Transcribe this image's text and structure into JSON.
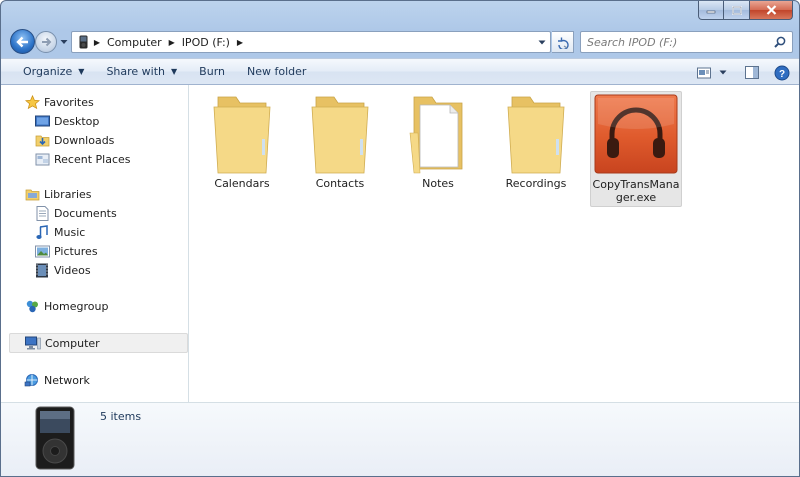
{
  "window": {
    "caption_buttons": [
      "minimize",
      "maximize",
      "close"
    ]
  },
  "address": {
    "breadcrumbs": [
      "Computer",
      "IPOD (F:)"
    ],
    "drive_icon": "ipod-drive-icon"
  },
  "search": {
    "placeholder": "Search IPOD (F:)"
  },
  "toolbar": {
    "organize_label": "Organize",
    "share_label": "Share with",
    "burn_label": "Burn",
    "new_folder_label": "New folder"
  },
  "sidebar": {
    "favorites_label": "Favorites",
    "favorites": [
      {
        "label": "Desktop",
        "icon": "desktop-icon"
      },
      {
        "label": "Downloads",
        "icon": "downloads-icon"
      },
      {
        "label": "Recent Places",
        "icon": "recent-places-icon"
      }
    ],
    "libraries_label": "Libraries",
    "libraries": [
      {
        "label": "Documents",
        "icon": "documents-icon"
      },
      {
        "label": "Music",
        "icon": "music-icon"
      },
      {
        "label": "Pictures",
        "icon": "pictures-icon"
      },
      {
        "label": "Videos",
        "icon": "videos-icon"
      }
    ],
    "homegroup_label": "Homegroup",
    "computer_label": "Computer",
    "network_label": "Network",
    "selected": "Computer"
  },
  "files": [
    {
      "name": "Calendars",
      "type": "folder"
    },
    {
      "name": "Contacts",
      "type": "folder"
    },
    {
      "name": "Notes",
      "type": "folder-with-document"
    },
    {
      "name": "Recordings",
      "type": "folder"
    },
    {
      "name": "CopyTransMana ger.exe",
      "type": "application",
      "selected": true
    }
  ],
  "details": {
    "item_count": "5 items",
    "device_icon": "ipod-classic-icon"
  },
  "colors": {
    "accent": "#1e395b",
    "folder": "#f3d47c",
    "app_icon": "#e0582e"
  }
}
